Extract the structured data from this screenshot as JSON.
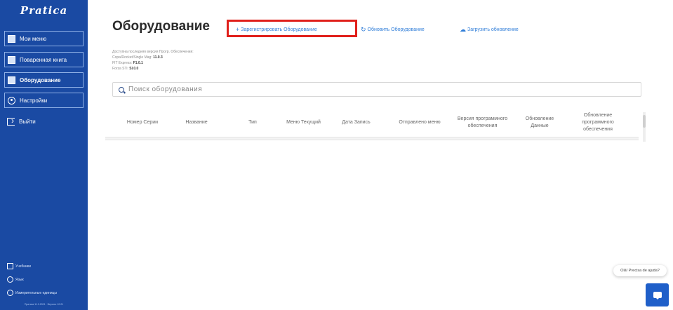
{
  "brand": {
    "logo": "Pratica",
    "tagline": ""
  },
  "sidebar": {
    "items": [
      {
        "label": "Мои меню",
        "icon": "book-icon"
      },
      {
        "label": "Поваренная книга",
        "icon": "book-icon"
      },
      {
        "label": "Оборудование",
        "icon": "book-icon"
      },
      {
        "label": "Настройки",
        "icon": "gear-icon"
      },
      {
        "label": "Выйти",
        "icon": "exit-icon"
      }
    ],
    "footer": [
      {
        "label": "Учебники",
        "icon": "tutorial-icon"
      },
      {
        "label": "Язык",
        "icon": "globe-icon"
      },
      {
        "label": "Измерительные единицы",
        "icon": "units-icon"
      }
    ],
    "version": "Пратика 11.0.2021 · Версия: 10.21"
  },
  "main": {
    "title": "Оборудование",
    "actions": [
      {
        "label": "Зарегистрировать Оборудование",
        "glyph": "+"
      },
      {
        "label": "Обновить Оборудование",
        "glyph": "↻"
      },
      {
        "label": "Загрузить обновление",
        "glyph": "☁"
      }
    ],
    "info": {
      "header": "Доступна последняя версия Прогр. Обеспечения:",
      "lines": [
        {
          "label": "Copa/Rocket/Single Mag:",
          "value": "11.0.3"
        },
        {
          "label": "FIT Express:",
          "value": "F1.0.1"
        },
        {
          "label": "Forza STi:",
          "value": "SI.0.0"
        }
      ]
    },
    "search": {
      "placeholder": "Поиск оборудования",
      "value": ""
    },
    "table": {
      "columns": [
        "Номер Серии",
        "Название",
        "Тип",
        "Меню Текущий",
        "Дата Запись",
        "Отправлено меню",
        "Версия программного обеспечения",
        "Обновление Данные",
        "Обновление программного обеспечения"
      ],
      "rows": []
    }
  },
  "help": {
    "bubble": "Olá! Precisa de ajuda?"
  },
  "colors": {
    "sidebar": "#1a4aa3",
    "link": "#2f7dd8",
    "highlight": "#e0201b",
    "help": "#1f5fc9"
  }
}
